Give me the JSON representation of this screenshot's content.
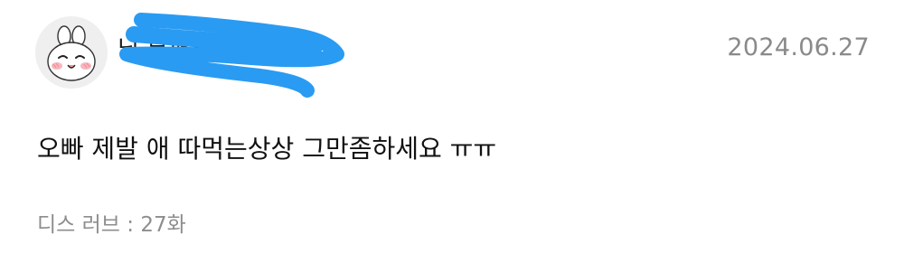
{
  "comment": {
    "username": "님 무퍼얼",
    "date": "2024.06.27",
    "text": "오빠 제발 애 따먹는상상 그만좀하세요 ㅠㅠ",
    "episode": "디스 러브 : 27화"
  },
  "colors": {
    "redaction": "#2a9bf2",
    "avatar_bg": "#efefef",
    "cheek": "#f6b6bf",
    "date_text": "#8a8a8a"
  },
  "icons": {
    "avatar": "bunny-character-icon"
  }
}
